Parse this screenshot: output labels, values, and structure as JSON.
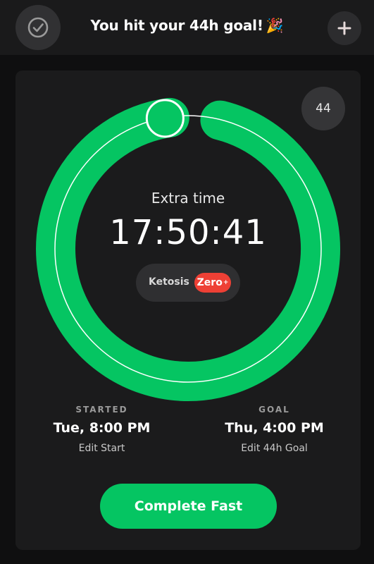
{
  "header": {
    "title": "You hit your 44h goal!",
    "emoji": "🎉"
  },
  "goal_chip": "44",
  "progress": {
    "extra_label": "Extra time",
    "elapsed": "17:50:41",
    "fraction_complete": 1.0,
    "ring_color": "#05c562",
    "knob_color": "#05c562"
  },
  "zone": {
    "label": "Ketosis",
    "badge": "Zero",
    "badge_plus": "+",
    "badge_color": "#ee4035"
  },
  "started": {
    "heading": "STARTED",
    "value": "Tue, 8:00 PM",
    "edit": "Edit Start"
  },
  "goal": {
    "heading": "GOAL",
    "value": "Thu, 4:00 PM",
    "edit": "Edit 44h Goal"
  },
  "complete_button": "Complete Fast",
  "icons": {
    "left": "check-circle-icon",
    "right": "plus-icon"
  }
}
